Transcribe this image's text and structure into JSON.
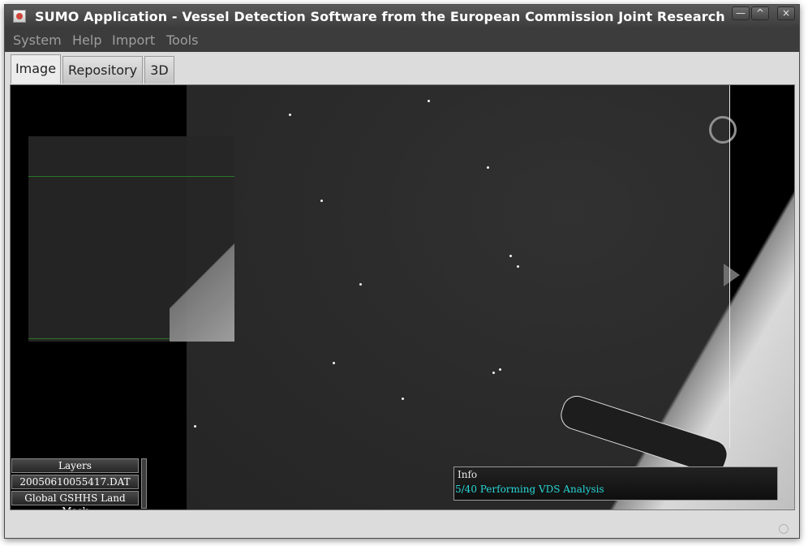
{
  "window": {
    "title": "SUMO Application - Vessel Detection Software from the European Commission Joint Research",
    "minimize_icon": "minimize-icon",
    "maximize_icon": "maximize-icon",
    "close_icon": "close-icon"
  },
  "menubar": {
    "items": [
      "System",
      "Help",
      "Import",
      "Tools"
    ]
  },
  "tabs": [
    {
      "label": "Image",
      "active": true
    },
    {
      "label": "Repository",
      "active": false
    },
    {
      "label": "3D",
      "active": false
    }
  ],
  "layers_panel": {
    "title": "Layers",
    "items": [
      "20050610055417.DAT",
      "Global GSHHS Land Mask"
    ]
  },
  "info_panel": {
    "title": "Info",
    "status": "5/40 Performing VDS Analysis"
  },
  "colors": {
    "accent_status": "#28d6d6",
    "overview_frame": "#2c7c2c"
  }
}
